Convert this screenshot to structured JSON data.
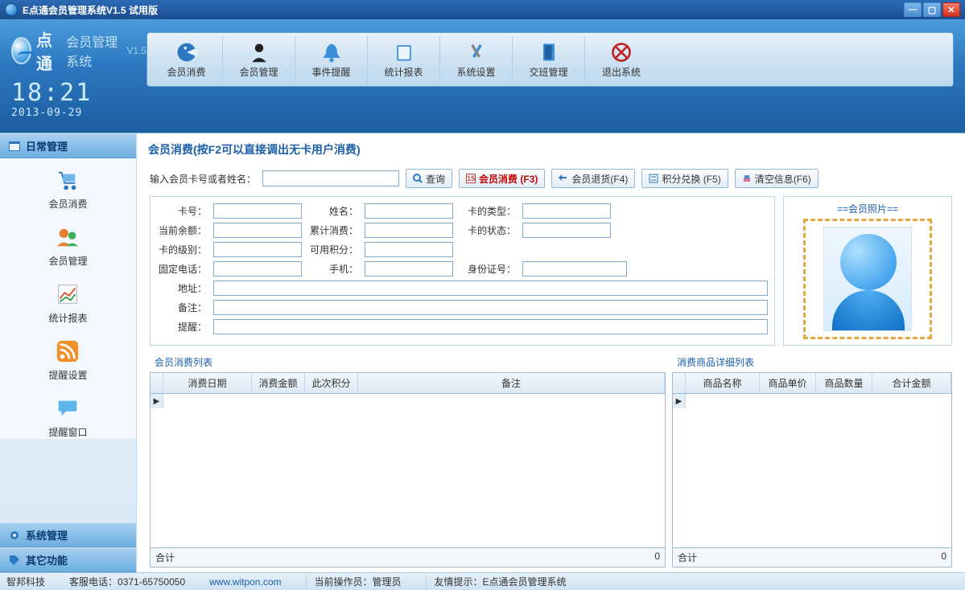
{
  "window": {
    "title": "E点通会员管理系统V1.5  试用版"
  },
  "brand": {
    "cn": "点通",
    "sub": "会员管理系统",
    "ver": "V1.5"
  },
  "clock": {
    "time": "18:21",
    "date": "2013-09-29"
  },
  "toolbar": [
    {
      "label": "会员消费"
    },
    {
      "label": "会员管理"
    },
    {
      "label": "事件提醒"
    },
    {
      "label": "统计报表"
    },
    {
      "label": "系统设置"
    },
    {
      "label": "交班管理"
    },
    {
      "label": "退出系统"
    }
  ],
  "sidebar": {
    "sections": {
      "daily": "日常管理",
      "system": "系统管理",
      "other": "其它功能"
    },
    "items": [
      {
        "label": "会员消费"
      },
      {
        "label": "会员管理"
      },
      {
        "label": "统计报表"
      },
      {
        "label": "提醒设置"
      },
      {
        "label": "提醒窗口"
      }
    ]
  },
  "panel": {
    "title": "会员消费(按F2可以直接调出无卡用户消费)",
    "search_label": "输入会员卡号或者姓名：",
    "btn_search": "查询",
    "btn_consume": "会员消费 (F3)",
    "btn_return": "会员退货(F4)",
    "btn_points": "积分兑换 (F5)",
    "btn_clear": "清空信息(F6)"
  },
  "form": {
    "card_no": {
      "label": "卡号：",
      "value": ""
    },
    "name": {
      "label": "姓名：",
      "value": ""
    },
    "card_type": {
      "label": "卡的类型：",
      "value": ""
    },
    "balance": {
      "label": "当前余额：",
      "value": ""
    },
    "total_spend": {
      "label": "累计消费：",
      "value": ""
    },
    "card_status": {
      "label": "卡的状态：",
      "value": ""
    },
    "card_level": {
      "label": "卡的级别：",
      "value": ""
    },
    "avail_points": {
      "label": "可用积分：",
      "value": ""
    },
    "tel": {
      "label": "固定电话：",
      "value": ""
    },
    "mobile": {
      "label": "手机：",
      "value": ""
    },
    "id_no": {
      "label": "身份证号：",
      "value": ""
    },
    "address": {
      "label": "地址：",
      "value": ""
    },
    "remark": {
      "label": "备注：",
      "value": ""
    },
    "remind": {
      "label": "提醒：",
      "value": ""
    }
  },
  "photo": {
    "title": "==会员照片=="
  },
  "tables": {
    "consume": {
      "title": "会员消费列表",
      "cols": [
        "消费日期",
        "消费金额",
        "此次积分",
        "备注"
      ],
      "footer_label": "合计",
      "footer_value": "0"
    },
    "goods": {
      "title": "消费商品详细列表",
      "cols": [
        "商品名称",
        "商品单价",
        "商品数量",
        "合计金额"
      ],
      "footer_label": "合计",
      "footer_value": "0"
    }
  },
  "status": {
    "company": "智邦科技",
    "hotline_label": "客服电话：",
    "hotline": "0371-65750050",
    "website": "www.witpon.com",
    "operator_label": "当前操作员：",
    "operator": "管理员",
    "tip_label": "友情提示：",
    "tip": "E点通会员管理系统"
  }
}
